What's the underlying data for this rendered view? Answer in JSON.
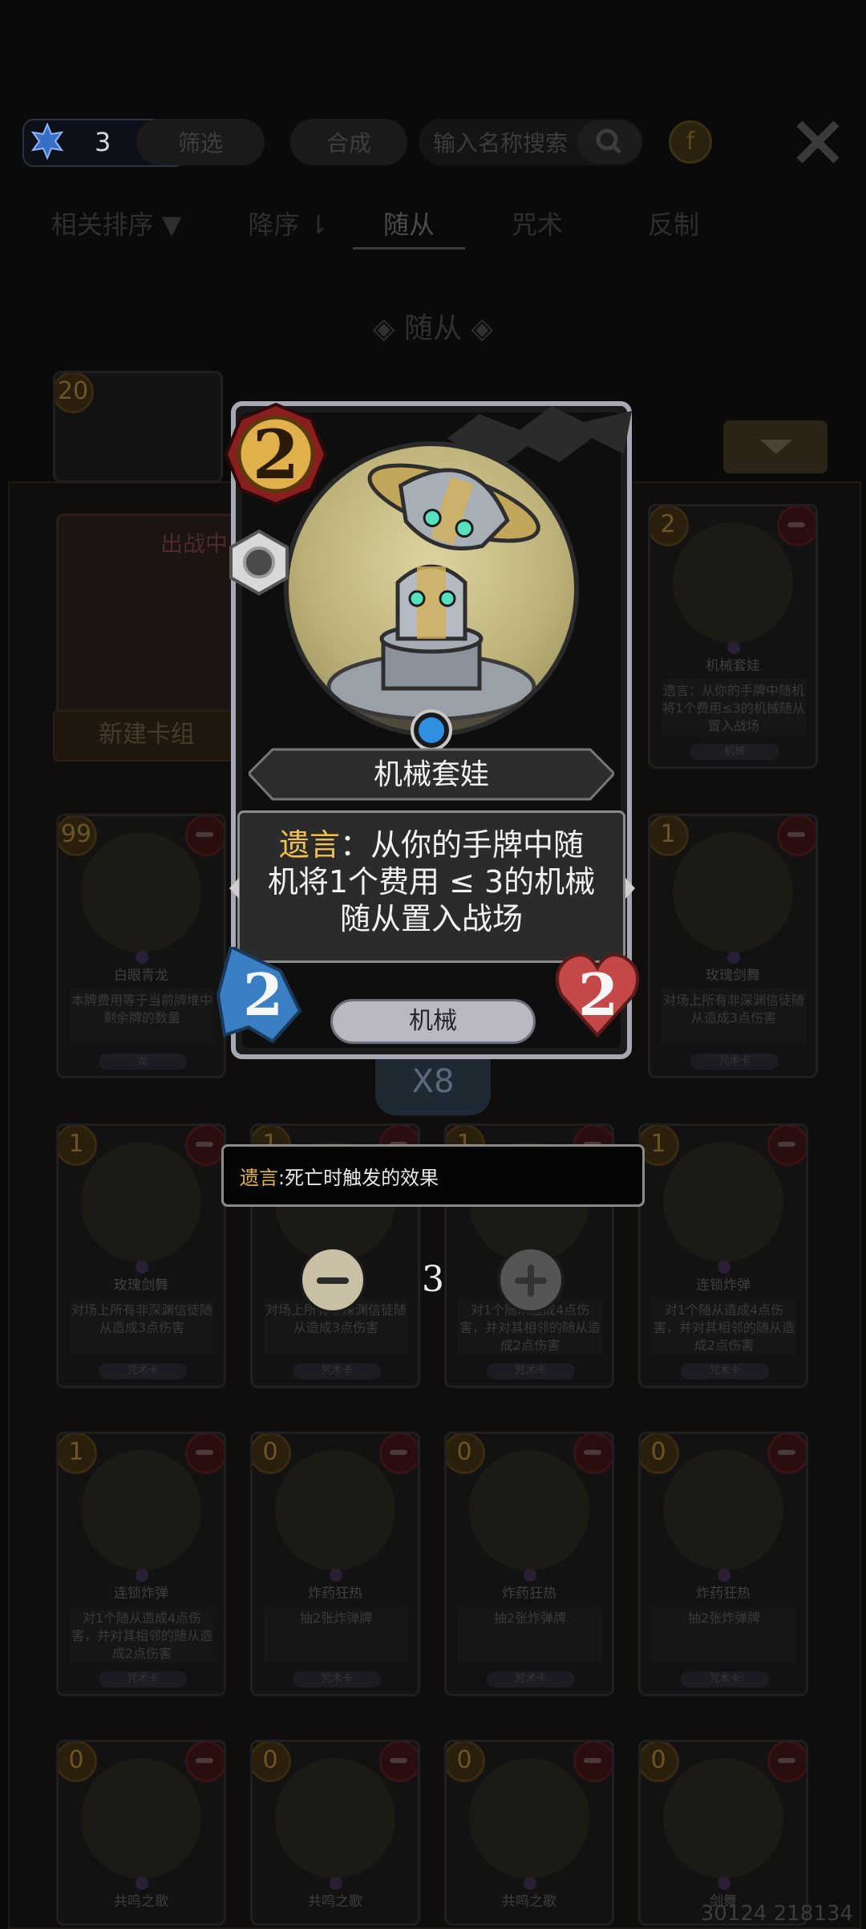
{
  "topbar": {
    "gem_count": "3",
    "filter_label": "筛选",
    "craft_label": "合成",
    "search_placeholder": "输入名称搜索",
    "coin_symbol": "f"
  },
  "tabs": [
    {
      "label": "相关排序 ▼"
    },
    {
      "label": "降序 ⇂"
    },
    {
      "label": "随从"
    },
    {
      "label": "咒术"
    },
    {
      "label": "反制"
    }
  ],
  "section_title": "◈ 随从 ◈",
  "deck": {
    "badge": "出战中",
    "new_deck_label": "新建卡组"
  },
  "grid_cards": [
    {
      "cost": "2",
      "name": "机械套娃",
      "desc": "遗言：从你的手牌中随机将1个费用≤3的机械随从置入战场",
      "type": "机械"
    },
    {
      "cost": "99",
      "name": "白眼青龙",
      "desc": "本牌费用等于当前牌堆中剩余牌的数量",
      "type": "龙"
    },
    {
      "cost": "1",
      "name": "玫瑰剑舞",
      "desc": "对场上所有非深渊信徒随从造成3点伤害",
      "type": "咒术卡"
    },
    {
      "cost": "1",
      "name": "玫瑰剑舞",
      "desc": "对场上所有非深渊信徒随从造成3点伤害",
      "type": "咒术卡"
    },
    {
      "cost": "1",
      "name": "玫瑰剑舞",
      "desc": "对场上所有非深渊信徒随从造成3点伤害",
      "type": "咒术卡"
    },
    {
      "cost": "1",
      "name": "连锁炸弹",
      "desc": "对1个随从造成4点伤害，并对其相邻的随从造成2点伤害",
      "type": "咒术卡"
    },
    {
      "cost": "1",
      "name": "连锁炸弹",
      "desc": "对1个随从造成4点伤害，并对其相邻的随从造成2点伤害",
      "type": "咒术卡"
    },
    {
      "cost": "1",
      "name": "连锁炸弹",
      "desc": "对1个随从造成4点伤害，并对其相邻的随从造成2点伤害",
      "type": "咒术卡"
    },
    {
      "cost": "0",
      "name": "炸药狂热",
      "desc": "抽2张炸弹牌",
      "type": "咒术卡"
    },
    {
      "cost": "0",
      "name": "炸药狂热",
      "desc": "抽2张炸弹牌",
      "type": "咒术卡"
    },
    {
      "cost": "0",
      "name": "炸药狂热",
      "desc": "抽2张炸弹牌",
      "type": "咒术卡"
    },
    {
      "cost": "0",
      "name": "共鸣之歌",
      "desc": "",
      "type": ""
    },
    {
      "cost": "0",
      "name": "共鸣之歌",
      "desc": "",
      "type": ""
    },
    {
      "cost": "0",
      "name": "共鸣之歌",
      "desc": "",
      "type": ""
    },
    {
      "cost": "0",
      "name": "剑舞",
      "desc": "",
      "type": ""
    }
  ],
  "detail_card": {
    "cost": "2",
    "name": "机械套娃",
    "desc_keyword": "遗言",
    "desc_line1_rest": "：从你的手牌中随",
    "desc_line2": "机将1个费用 ≤ 3的机械",
    "desc_line3": "随从置入战场",
    "attack": "2",
    "health": "2",
    "tribe": "机械",
    "owned_count": "X8"
  },
  "tooltip": {
    "keyword": "遗言",
    "text": ":死亡时触发的效果"
  },
  "stepper": {
    "value": "3"
  },
  "footer_id": "30124 218134",
  "colors": {
    "keyword": "#f0c050",
    "gem": "#2f8fe0",
    "attack_badge": "#3a7fc4",
    "health_badge": "#c44848",
    "cost_badge": "#d9a43a"
  }
}
